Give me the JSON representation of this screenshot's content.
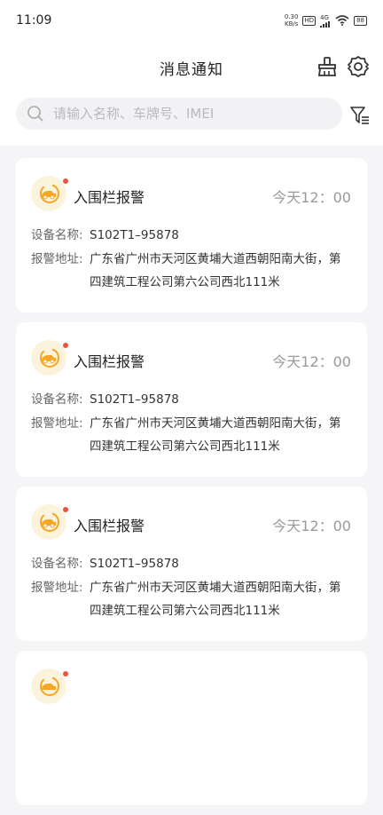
{
  "status_bar": {
    "time": "11:09",
    "speed_value": "0.30",
    "speed_unit": "KB/s",
    "hd": "HD",
    "network": "4G",
    "battery": "88"
  },
  "header": {
    "title": "消息通知",
    "icons": [
      "broom-icon",
      "gear-icon"
    ]
  },
  "search": {
    "placeholder": "请输入名称、车牌号、IMEI",
    "filter_icon": "filter-icon"
  },
  "notifications": [
    {
      "title": "入围栏报警",
      "time": "今天12：00",
      "device_label": "设备名称:",
      "device_value": "S102T1–95878",
      "address_label": "报警地址:",
      "address_value": "广东省广州市天河区黄埔大道西朝阳南大街，第四建筑工程公司第六公司西北111米",
      "icon": "car-alarm-icon",
      "unread": true
    },
    {
      "title": "入围栏报警",
      "time": "今天12：00",
      "device_label": "设备名称:",
      "device_value": "S102T1–95878",
      "address_label": "报警地址:",
      "address_value": "广东省广州市天河区黄埔大道西朝阳南大街，第四建筑工程公司第六公司西北111米",
      "icon": "car-alarm-icon",
      "unread": true
    },
    {
      "title": "入围栏报警",
      "time": "今天12：00",
      "device_label": "设备名称:",
      "device_value": "S102T1–95878",
      "address_label": "报警地址:",
      "address_value": "广东省广州市天河区黄埔大道西朝阳南大街，第四建筑工程公司第六公司西北111米",
      "icon": "car-alarm-icon",
      "unread": true
    },
    {
      "title": "",
      "time": "",
      "device_label": "",
      "device_value": "",
      "address_label": "",
      "address_value": "",
      "icon": "car-alarm-icon",
      "unread": true
    }
  ],
  "colors": {
    "accent": "#f5a623",
    "unread_dot": "#f0533d",
    "background": "#f5f5f7"
  }
}
